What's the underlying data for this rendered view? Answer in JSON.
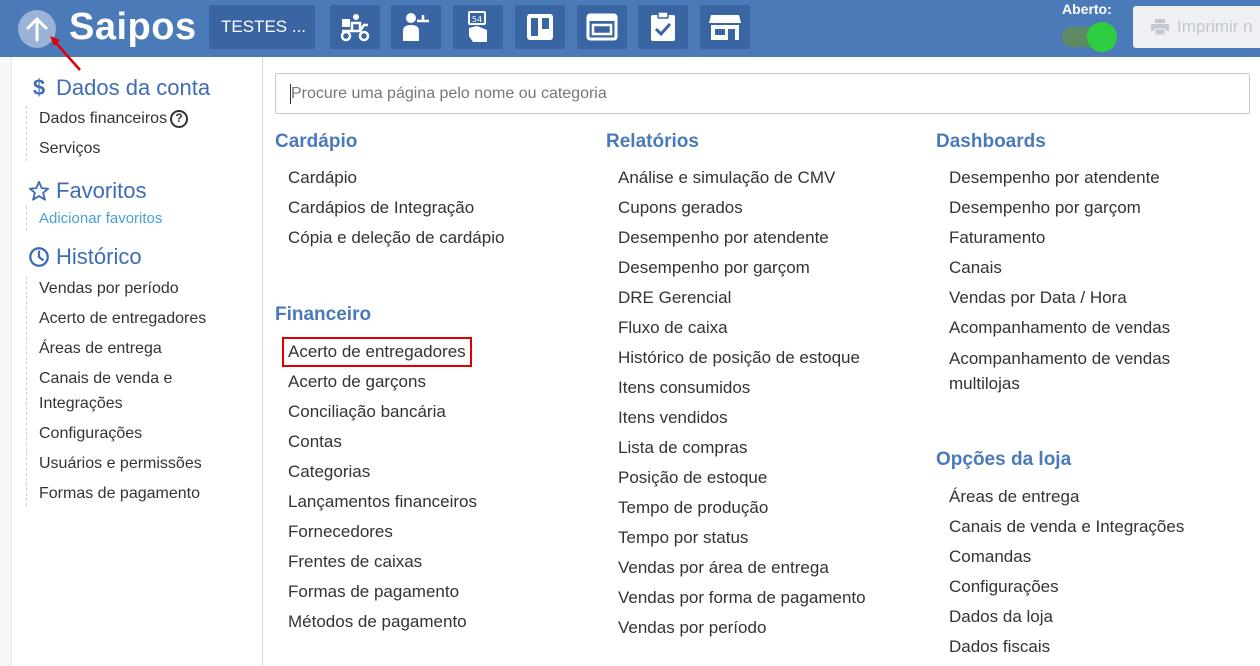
{
  "header": {
    "brand": "Saipos",
    "store_label": "TESTES ...",
    "status_label": "Aberto:",
    "print_label": "Imprimir n",
    "nav_icons": [
      "delivery-icon",
      "waiter-icon",
      "table-54-icon",
      "kanban-icon",
      "window-icon",
      "checklist-icon",
      "store-icon"
    ]
  },
  "sidebar": {
    "account": {
      "title": "Dados da conta",
      "items": [
        "Dados financeiros",
        "Serviços"
      ]
    },
    "favorites": {
      "title": "Favoritos",
      "add_link": "Adicionar favoritos"
    },
    "history": {
      "title": "Histórico",
      "items": [
        "Vendas por período",
        "Acerto de entregadores",
        "Áreas de entrega",
        "Canais de venda e Integrações",
        "Configurações",
        "Usuários e permissões",
        "Formas de pagamento"
      ]
    }
  },
  "search": {
    "placeholder": "Procure uma página pelo nome ou categoria"
  },
  "sections": {
    "cardapio": {
      "title": "Cardápio",
      "items": [
        "Cardápio",
        "Cardápios de Integração",
        "Cópia e deleção de cardápio"
      ]
    },
    "financeiro": {
      "title": "Financeiro",
      "items": [
        "Acerto de entregadores",
        "Acerto de garçons",
        "Conciliação bancária",
        "Contas",
        "Categorias",
        "Lançamentos financeiros",
        "Fornecedores",
        "Frentes de caixas",
        "Formas de pagamento",
        "Métodos de pagamento"
      ]
    },
    "relatorios": {
      "title": "Relatórios",
      "items": [
        "Análise e simulação de CMV",
        "Cupons gerados",
        "Desempenho por atendente",
        "Desempenho por garçom",
        "DRE Gerencial",
        "Fluxo de caixa",
        "Histórico de posição de estoque",
        "Itens consumidos",
        "Itens vendidos",
        "Lista de compras",
        "Posição de estoque",
        "Tempo de produção",
        "Tempo por status",
        "Vendas por área de entrega",
        "Vendas por forma de pagamento",
        "Vendas por período"
      ]
    },
    "dashboards": {
      "title": "Dashboards",
      "items": [
        "Desempenho por atendente",
        "Desempenho por garçom",
        "Faturamento",
        "Canais",
        "Vendas por Data / Hora",
        "Acompanhamento de vendas",
        "Acompanhamento de vendas multilojas"
      ]
    },
    "opcoes": {
      "title": "Opções da loja",
      "items": [
        "Áreas de entrega",
        "Canais de venda e Integrações",
        "Comandas",
        "Configurações",
        "Dados da loja",
        "Dados fiscais"
      ]
    }
  },
  "colors": {
    "header_bg": "#4a7ab8",
    "accent": "#3d6db4",
    "highlight_border": "#e00000",
    "toggle_on": "#2ecc40"
  }
}
